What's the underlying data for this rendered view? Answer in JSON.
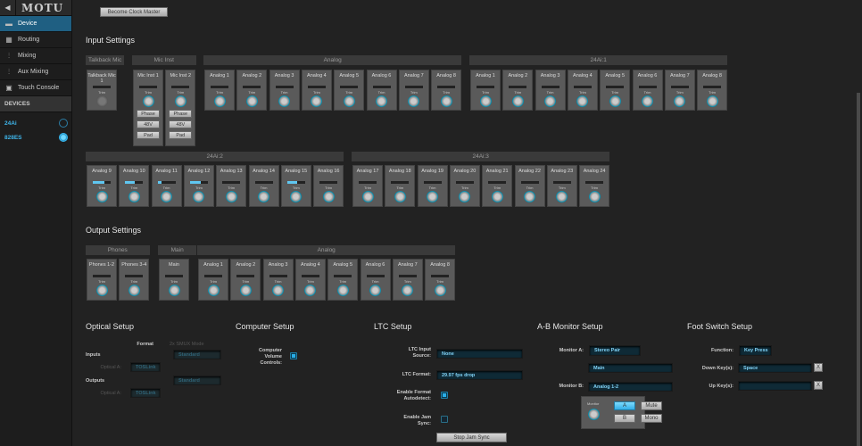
{
  "sidebar": {
    "logo": "MOTU",
    "nav": [
      {
        "label": "Device",
        "icon": "device-icon"
      },
      {
        "label": "Routing",
        "icon": "routing-grid-icon"
      },
      {
        "label": "Mixing",
        "icon": "mixing-faders-icon"
      },
      {
        "label": "Aux Mixing",
        "icon": "aux-mixing-icon"
      },
      {
        "label": "Touch Console",
        "icon": "touch-console-icon"
      }
    ],
    "devices_header": "DEVICES",
    "devices": [
      {
        "name": "24Ai",
        "selected": false
      },
      {
        "name": "828ES",
        "selected": true
      }
    ]
  },
  "toolbar": {
    "clock_master": "Become Clock Master"
  },
  "input_settings": {
    "title": "Input Settings",
    "row1": [
      {
        "header": "Talkback Mic",
        "channels": [
          {
            "label": "Talkback Mic 1",
            "level": 0,
            "disabled": true
          }
        ]
      },
      {
        "header": "Mic Inst",
        "channels": [
          {
            "label": "Mic Inst 1",
            "level": 0
          },
          {
            "label": "Mic Inst 2",
            "level": 0
          }
        ],
        "buttons": [
          "Phase",
          "48V",
          "Pad"
        ]
      },
      {
        "header": "Analog",
        "channels": [
          {
            "label": "Analog 1",
            "level": 0
          },
          {
            "label": "Analog 2",
            "level": 0
          },
          {
            "label": "Analog 3",
            "level": 0
          },
          {
            "label": "Analog 4",
            "level": 0
          },
          {
            "label": "Analog 5",
            "level": 0
          },
          {
            "label": "Analog 6",
            "level": 0
          },
          {
            "label": "Analog 7",
            "level": 0
          },
          {
            "label": "Analog 8",
            "level": 0
          }
        ]
      },
      {
        "header": "24Ai:1",
        "channels": [
          {
            "label": "Analog 1",
            "level": 0
          },
          {
            "label": "Analog 2",
            "level": 0
          },
          {
            "label": "Analog 3",
            "level": 0
          },
          {
            "label": "Analog 4",
            "level": 0
          },
          {
            "label": "Analog 5",
            "level": 0
          },
          {
            "label": "Analog 6",
            "level": 0
          },
          {
            "label": "Analog 7",
            "level": 0
          },
          {
            "label": "Analog 8",
            "level": 0
          }
        ]
      }
    ],
    "row2": [
      {
        "header": "24Ai:2",
        "channels": [
          {
            "label": "Analog 9",
            "level": 0.65
          },
          {
            "label": "Analog 10",
            "level": 0.55
          },
          {
            "label": "Analog 11",
            "level": 0.2
          },
          {
            "label": "Analog 12",
            "level": 0.6
          },
          {
            "label": "Analog 13",
            "level": 0
          },
          {
            "label": "Analog 14",
            "level": 0
          },
          {
            "label": "Analog 15",
            "level": 0.55
          },
          {
            "label": "Analog 16",
            "level": 0
          }
        ]
      },
      {
        "header": "24Ai:3",
        "channels": [
          {
            "label": "Analog 17",
            "level": 0
          },
          {
            "label": "Analog 18",
            "level": 0
          },
          {
            "label": "Analog 19",
            "level": 0
          },
          {
            "label": "Analog 20",
            "level": 0
          },
          {
            "label": "Analog 21",
            "level": 0
          },
          {
            "label": "Analog 22",
            "level": 0
          },
          {
            "label": "Analog 23",
            "level": 0
          },
          {
            "label": "Analog 24",
            "level": 0
          }
        ]
      }
    ],
    "trim_label": "Trim"
  },
  "output_settings": {
    "title": "Output Settings",
    "groups": [
      {
        "header": "Phones",
        "channels": [
          {
            "label": "Phones 1-2",
            "level": 0
          },
          {
            "label": "Phones 3-4",
            "level": 0
          }
        ]
      },
      {
        "header": "Main",
        "channels": [
          {
            "label": "Main",
            "level": 0
          }
        ]
      },
      {
        "header": "Analog",
        "channels": [
          {
            "label": "Analog 1",
            "level": 0
          },
          {
            "label": "Analog 2",
            "level": 0
          },
          {
            "label": "Analog 3",
            "level": 0
          },
          {
            "label": "Analog 4",
            "level": 0
          },
          {
            "label": "Analog 5",
            "level": 0
          },
          {
            "label": "Analog 6",
            "level": 0
          },
          {
            "label": "Analog 7",
            "level": 0
          },
          {
            "label": "Analog 8",
            "level": 0
          }
        ]
      }
    ]
  },
  "optical": {
    "title": "Optical Setup",
    "format_header": "Format",
    "smux_header": "2x SMUX Mode",
    "inputs_label": "Inputs",
    "outputs_label": "Outputs",
    "input_port": "Optical A:",
    "input_format": "TOSLink",
    "input_smux": "Standard",
    "output_port": "Optical A:",
    "output_format": "TOSLink",
    "output_smux": "Standard"
  },
  "computer": {
    "title": "Computer Setup",
    "volume_label": "Computer Volume Controls:",
    "volume_checked": true
  },
  "ltc": {
    "title": "LTC Setup",
    "input_source_label": "LTC Input Source:",
    "input_source": "None",
    "format_label": "LTC Format:",
    "format": "29.97 fps drop",
    "autodetect_label": "Enable Format Autodetect:",
    "autodetect": true,
    "jam_label": "Enable Jam Sync:",
    "jam": false,
    "stop_jam": "Stop Jam Sync"
  },
  "ab_monitor": {
    "title": "A-B Monitor Setup",
    "monitor_a_label": "Monitor A:",
    "monitor_a": "Stereo Pair",
    "monitor_a2": "Main",
    "monitor_b_label": "Monitor B:",
    "monitor_b": "Analog 1-2",
    "knob_label": "Monitor",
    "a": "A",
    "b": "B",
    "mute": "Mute",
    "mono": "Mono"
  },
  "foot_switch": {
    "title": "Foot Switch Setup",
    "function_label": "Function:",
    "function": "Key Press",
    "down_label": "Down Key(s):",
    "down": "Space",
    "up_label": "Up Key(s):",
    "up": "",
    "clear": "X"
  }
}
